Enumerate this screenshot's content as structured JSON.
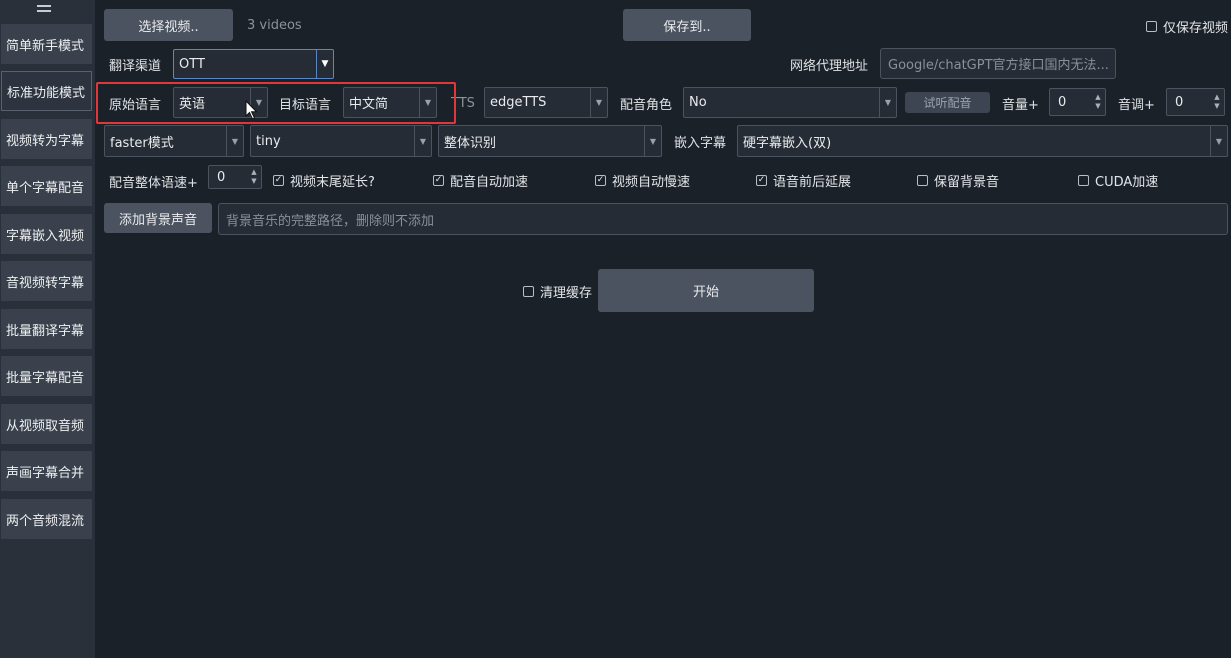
{
  "sidebar": {
    "items": [
      {
        "label": "简单新手模式"
      },
      {
        "label": "标准功能模式"
      },
      {
        "label": "视频转为字幕"
      },
      {
        "label": "单个字幕配音"
      },
      {
        "label": "字幕嵌入视频"
      },
      {
        "label": "音视频转字幕"
      },
      {
        "label": "批量翻译字幕"
      },
      {
        "label": "批量字幕配音"
      },
      {
        "label": "从视频取音频"
      },
      {
        "label": "声画字幕合并"
      },
      {
        "label": "两个音频混流"
      }
    ],
    "active_index": 1
  },
  "top": {
    "select_video_label": "选择视频..",
    "video_count": "3 videos",
    "save_to_label": "保存到..",
    "only_save_video_label": "仅保存视频"
  },
  "translate": {
    "channel_label": "翻译渠道",
    "channel_value": "OTT",
    "proxy_label": "网络代理地址",
    "proxy_placeholder": "Google/chatGPT官方接口国内无法..."
  },
  "language": {
    "source_label": "原始语言",
    "source_value": "英语",
    "target_label": "目标语言",
    "target_value": "中文简",
    "tts_label": "TTS",
    "tts_value": "edgeTTS",
    "voice_label": "配音角色",
    "voice_value": "No",
    "listen_button": "试听配音",
    "volume_label": "音量+",
    "volume_value": "0",
    "pitch_label": "音调+",
    "pitch_value": "0"
  },
  "recognition": {
    "mode_value": "faster模式",
    "model_value": "tiny",
    "split_value": "整体识别",
    "embed_label": "嵌入字幕",
    "embed_value": "硬字幕嵌入(双)"
  },
  "options": {
    "speed_label": "配音整体语速+",
    "speed_value": "0",
    "checks": [
      {
        "label": "视频末尾延长?",
        "checked": true
      },
      {
        "label": "配音自动加速",
        "checked": true
      },
      {
        "label": "视频自动慢速",
        "checked": true
      },
      {
        "label": "语音前后延展",
        "checked": true
      },
      {
        "label": "保留背景音",
        "checked": false
      },
      {
        "label": "CUDA加速",
        "checked": false
      }
    ]
  },
  "background": {
    "add_button": "添加背景声音",
    "path_placeholder": "背景音乐的完整路径，删除则不添加"
  },
  "actions": {
    "clear_cache_label": "清理缓存",
    "clear_cache_checked": false,
    "start_label": "开始"
  },
  "colors": {
    "background": "#1b2129",
    "sidebar": "#2a3039",
    "button": "#4a535f",
    "highlight": "#e0383a",
    "focus": "#5a87c6"
  }
}
